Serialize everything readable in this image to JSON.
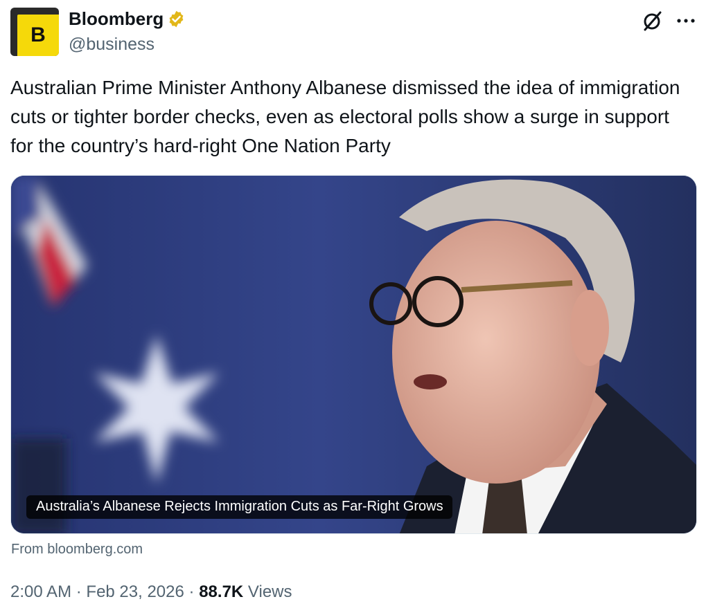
{
  "author": {
    "display_name": "Bloomberg",
    "handle": "@business",
    "avatar_letter": "B",
    "verified_icon": "verified-gold-badge-icon"
  },
  "actions": {
    "grok_icon": "grok-icon",
    "more_icon": "more-options-icon"
  },
  "tweet": {
    "text": "Australian Prime Minister Anthony Albanese dismissed the idea of immigration cuts or tighter border checks, even as electoral polls show a surge in support for the country’s hard-right One Nation Party"
  },
  "card": {
    "title": "Australia’s Albanese Rejects Immigration Cuts as Far-Right Grows",
    "source": "From bloomberg.com"
  },
  "meta": {
    "time": "2:00 AM",
    "separator": "·",
    "date": "Feb 23, 2026",
    "views_count": "88.7K",
    "views_label": "Views"
  },
  "colors": {
    "brand_yellow": "#f5d90a",
    "verified_gold": "#e2b719",
    "secondary_text": "#536471",
    "primary_text": "#0f1419"
  }
}
